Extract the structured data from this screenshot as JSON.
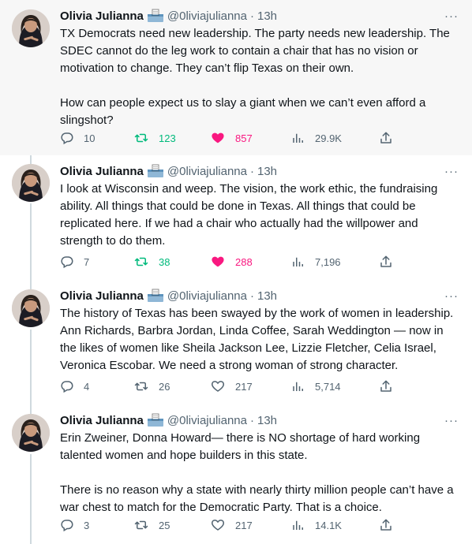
{
  "tweets": [
    {
      "author": "Olivia Julianna",
      "handle": "@0liviajulianna",
      "separator": "·",
      "time": "13h",
      "text": "TX Democrats need new leadership. The party needs new leadership. The SDEC cannot do the leg work to contain a chair that has no vision or motivation to change. They can’t flip Texas on their own.\n\nHow can people expect us to slay a giant when we can’t even afford a slingshot?",
      "replies": "10",
      "retweets": "123",
      "likes": "857",
      "views": "29.9K",
      "retweeted": true,
      "liked": true
    },
    {
      "author": "Olivia Julianna",
      "handle": "@0liviajulianna",
      "separator": "·",
      "time": "13h",
      "text": "I look at Wisconsin and weep. The vision, the work ethic, the fundraising ability. All things that could be done in Texas. All things that could be replicated here. If we had a chair who actually had the willpower and strength to do them.",
      "replies": "7",
      "retweets": "38",
      "likes": "288",
      "views": "7,196",
      "retweeted": true,
      "liked": true
    },
    {
      "author": "Olivia Julianna",
      "handle": "@0liviajulianna",
      "separator": "·",
      "time": "13h",
      "text": "The history of Texas has been swayed by the work of women in leadership. Ann Richards, Barbra Jordan, Linda Coffee, Sarah Weddington — now in the likes of women like Sheila Jackson Lee, Lizzie Fletcher, Celia Israel, Veronica Escobar. We need a strong woman of strong character.",
      "replies": "4",
      "retweets": "26",
      "likes": "217",
      "views": "5,714",
      "retweeted": false,
      "liked": false
    },
    {
      "author": "Olivia Julianna",
      "handle": "@0liviajulianna",
      "separator": "·",
      "time": "13h",
      "text": "Erin Zweiner, Donna Howard— there is NO shortage of hard working talented women and hope builders in this state.\n\nThere is no reason why a state with nearly thirty million people can’t have a war chest to match for the Democratic Party. That is a choice.",
      "replies": "3",
      "retweets": "25",
      "likes": "217",
      "views": "14.1K",
      "retweeted": false,
      "liked": false
    }
  ],
  "more_label": "···",
  "icons": {
    "reply": "reply-icon",
    "retweet": "retweet-icon",
    "like": "heart-icon",
    "views": "views-icon",
    "share": "share-icon",
    "emoji": "ballot-box-emoji"
  },
  "colors": {
    "text": "#0f1419",
    "secondary": "#536471",
    "retweet_active": "#00ba7c",
    "like_active": "#f91880",
    "thread_line": "#cfd9de",
    "highlight_bg": "#f7f7f7"
  }
}
